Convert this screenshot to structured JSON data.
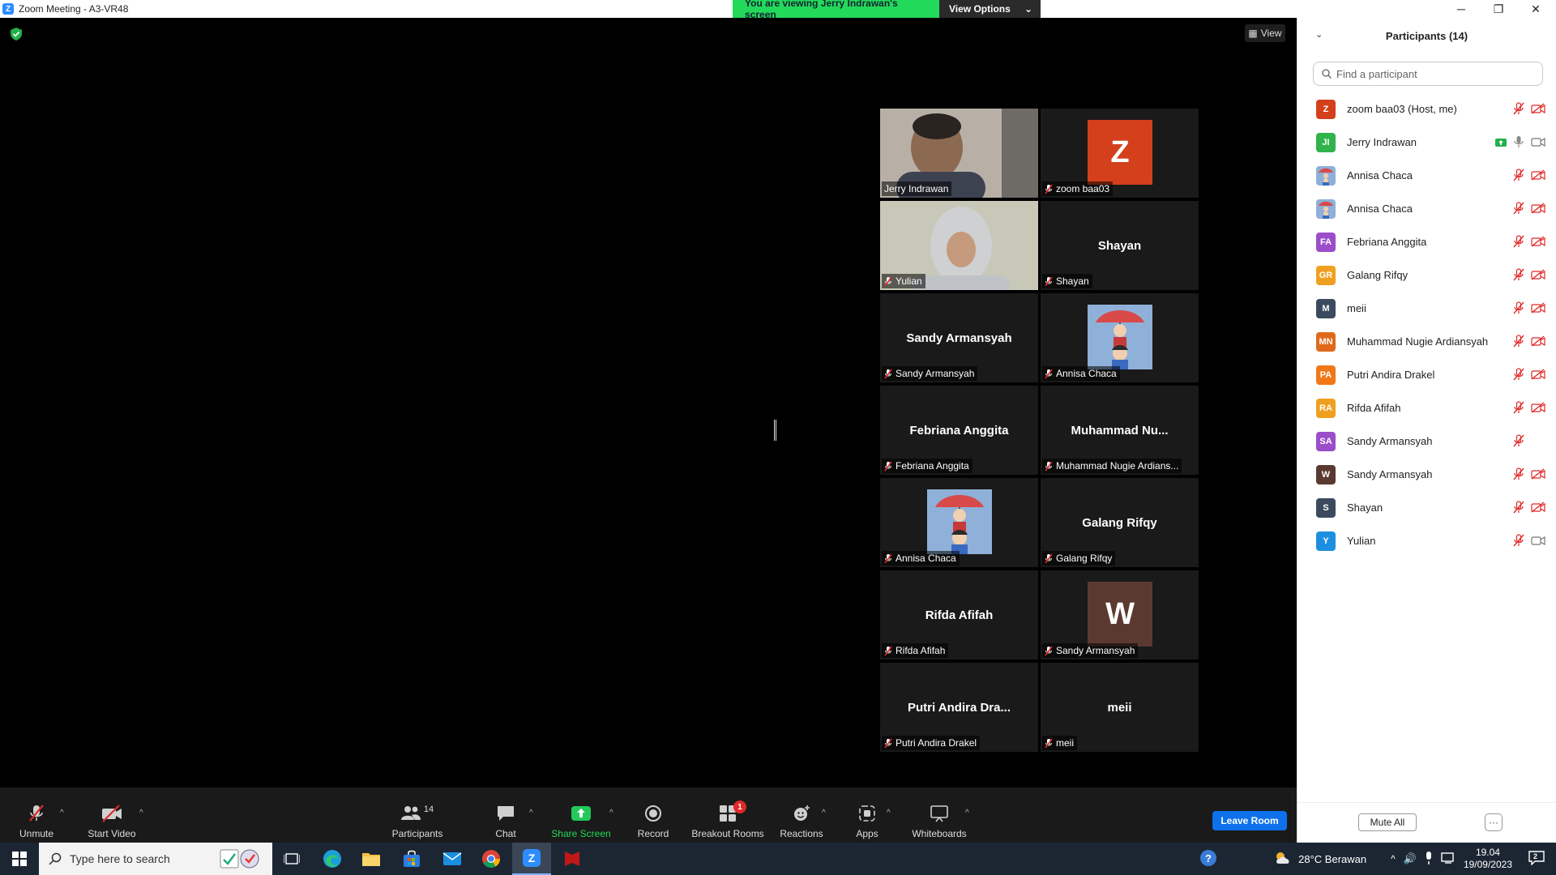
{
  "window": {
    "title": "Zoom Meeting - A3-VR48",
    "banner_text": "You are viewing Jerry Indrawan's screen",
    "view_options": "View Options",
    "view_label": "View"
  },
  "tiles": [
    {
      "center": "",
      "tag": "Jerry Indrawan",
      "kind": "video-man",
      "muted": false,
      "active": true
    },
    {
      "center": "",
      "tag": "zoom baa03",
      "kind": "avatar",
      "letter": "Z",
      "color": "#d4401c",
      "muted": true
    },
    {
      "center": "",
      "tag": "Yulian",
      "kind": "video-woman",
      "muted": true
    },
    {
      "center": "Shayan",
      "tag": "Shayan",
      "kind": "name",
      "muted": true
    },
    {
      "center": "Sandy Armansyah",
      "tag": "Sandy Armansyah",
      "kind": "name",
      "muted": true
    },
    {
      "center": "",
      "tag": "Annisa Chaca",
      "kind": "picture",
      "muted": true
    },
    {
      "center": "Febriana Anggita",
      "tag": "Febriana Anggita",
      "kind": "name",
      "muted": true
    },
    {
      "center": "Muhammad  Nu...",
      "tag": "Muhammad Nugie Ardians...",
      "kind": "name",
      "muted": true
    },
    {
      "center": "",
      "tag": "Annisa Chaca",
      "kind": "picture",
      "muted": true
    },
    {
      "center": "Galang Rifqy",
      "tag": "Galang Rifqy",
      "kind": "name",
      "muted": true
    },
    {
      "center": "Rifda Afifah",
      "tag": "Rifda Afifah",
      "kind": "name",
      "muted": true
    },
    {
      "center": "",
      "tag": "Sandy Armansyah",
      "kind": "avatar",
      "letter": "W",
      "color": "#5a3a30",
      "muted": true
    },
    {
      "center": "Putri  Andira  Dra...",
      "tag": "Putri Andira Drakel",
      "kind": "name",
      "muted": true
    },
    {
      "center": "meii",
      "tag": "meii",
      "kind": "name",
      "muted": true
    }
  ],
  "toolbar": {
    "unmute": "Unmute",
    "start_video": "Start Video",
    "participants": "Participants",
    "participants_count": "14",
    "chat": "Chat",
    "share_screen": "Share Screen",
    "record": "Record",
    "breakout_rooms": "Breakout Rooms",
    "breakout_badge": "1",
    "reactions": "Reactions",
    "apps": "Apps",
    "whiteboards": "Whiteboards",
    "leave_room": "Leave Room"
  },
  "panel": {
    "title": "Participants (14)",
    "search_placeholder": "Find a participant",
    "mute_all": "Mute All",
    "more": "···",
    "participants": [
      {
        "initials": "Z",
        "name": "zoom baa03 (Host, me)",
        "color": "#d4401c",
        "mic": "muted",
        "video": "off"
      },
      {
        "initials": "JI",
        "name": "Jerry Indrawan",
        "color": "#2fb34a",
        "mic": "on",
        "video": "on",
        "sharing": true
      },
      {
        "initials": "",
        "name": "Annisa Chaca",
        "color": "#7a9cc6",
        "mic": "muted",
        "video": "off",
        "picture": true
      },
      {
        "initials": "",
        "name": "Annisa Chaca",
        "color": "#7a9cc6",
        "mic": "muted",
        "video": "off",
        "picture": true
      },
      {
        "initials": "FA",
        "name": "Febriana Anggita",
        "color": "#9b4dca",
        "mic": "muted",
        "video": "off"
      },
      {
        "initials": "GR",
        "name": "Galang Rifqy",
        "color": "#f0a020",
        "mic": "muted",
        "video": "off"
      },
      {
        "initials": "M",
        "name": "meii",
        "color": "#3b4a5e",
        "mic": "muted",
        "video": "off"
      },
      {
        "initials": "MN",
        "name": "Muhammad Nugie Ardiansyah",
        "color": "#e06a1a",
        "mic": "muted",
        "video": "off"
      },
      {
        "initials": "PA",
        "name": "Putri Andira Drakel",
        "color": "#f07818",
        "mic": "muted",
        "video": "off"
      },
      {
        "initials": "RA",
        "name": "Rifda Afifah",
        "color": "#f0a020",
        "mic": "muted",
        "video": "off"
      },
      {
        "initials": "SA",
        "name": "Sandy Armansyah",
        "color": "#9b4dca",
        "mic": "muted",
        "video": "none"
      },
      {
        "initials": "W",
        "name": "Sandy Armansyah",
        "color": "#5a3a30",
        "mic": "muted",
        "video": "off"
      },
      {
        "initials": "S",
        "name": "Shayan",
        "color": "#3b4a5e",
        "mic": "muted",
        "video": "off"
      },
      {
        "initials": "Y",
        "name": "Yulian",
        "color": "#1e8fe0",
        "mic": "muted",
        "video": "on"
      }
    ]
  },
  "taskbar": {
    "search_placeholder": "Type here to search",
    "weather": "28°C  Berawan",
    "time": "19.04",
    "date": "19/09/2023",
    "notif_count": "2"
  },
  "colors": {
    "accent": "#0e71eb",
    "banner_green": "#23d959",
    "mute_red": "#e02828",
    "active_border": "#e5ea42"
  }
}
